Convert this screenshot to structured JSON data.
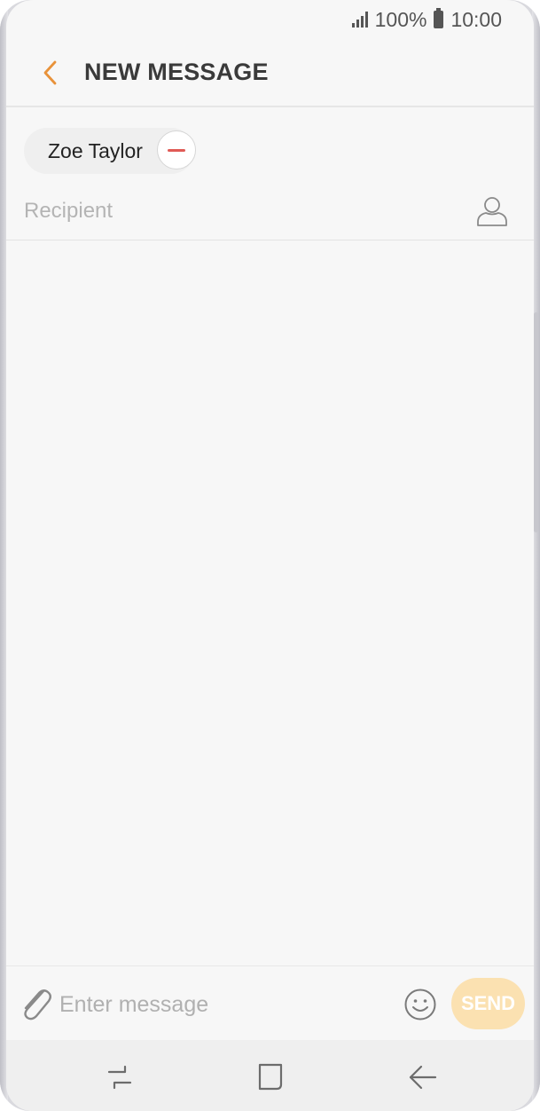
{
  "status_bar": {
    "battery": "100%",
    "time": "10:00"
  },
  "app_bar": {
    "title": "NEW MESSAGE"
  },
  "recipients": {
    "chips": [
      {
        "name": "Zoe Taylor"
      }
    ],
    "input_placeholder": "Recipient"
  },
  "compose": {
    "placeholder": "Enter message",
    "send_label": "SEND"
  },
  "icons": {
    "back": "back-arrow-icon",
    "contact": "contact-person-icon",
    "attach": "paperclip-icon",
    "emoji": "smiley-icon",
    "nav_recents": "recents-icon",
    "nav_home": "home-icon",
    "nav_back": "back-icon"
  },
  "colors": {
    "accent": "#e8923a",
    "send_disabled": "#fbe1b1",
    "remove_red": "#e05a55",
    "background": "#f7f7f7"
  }
}
